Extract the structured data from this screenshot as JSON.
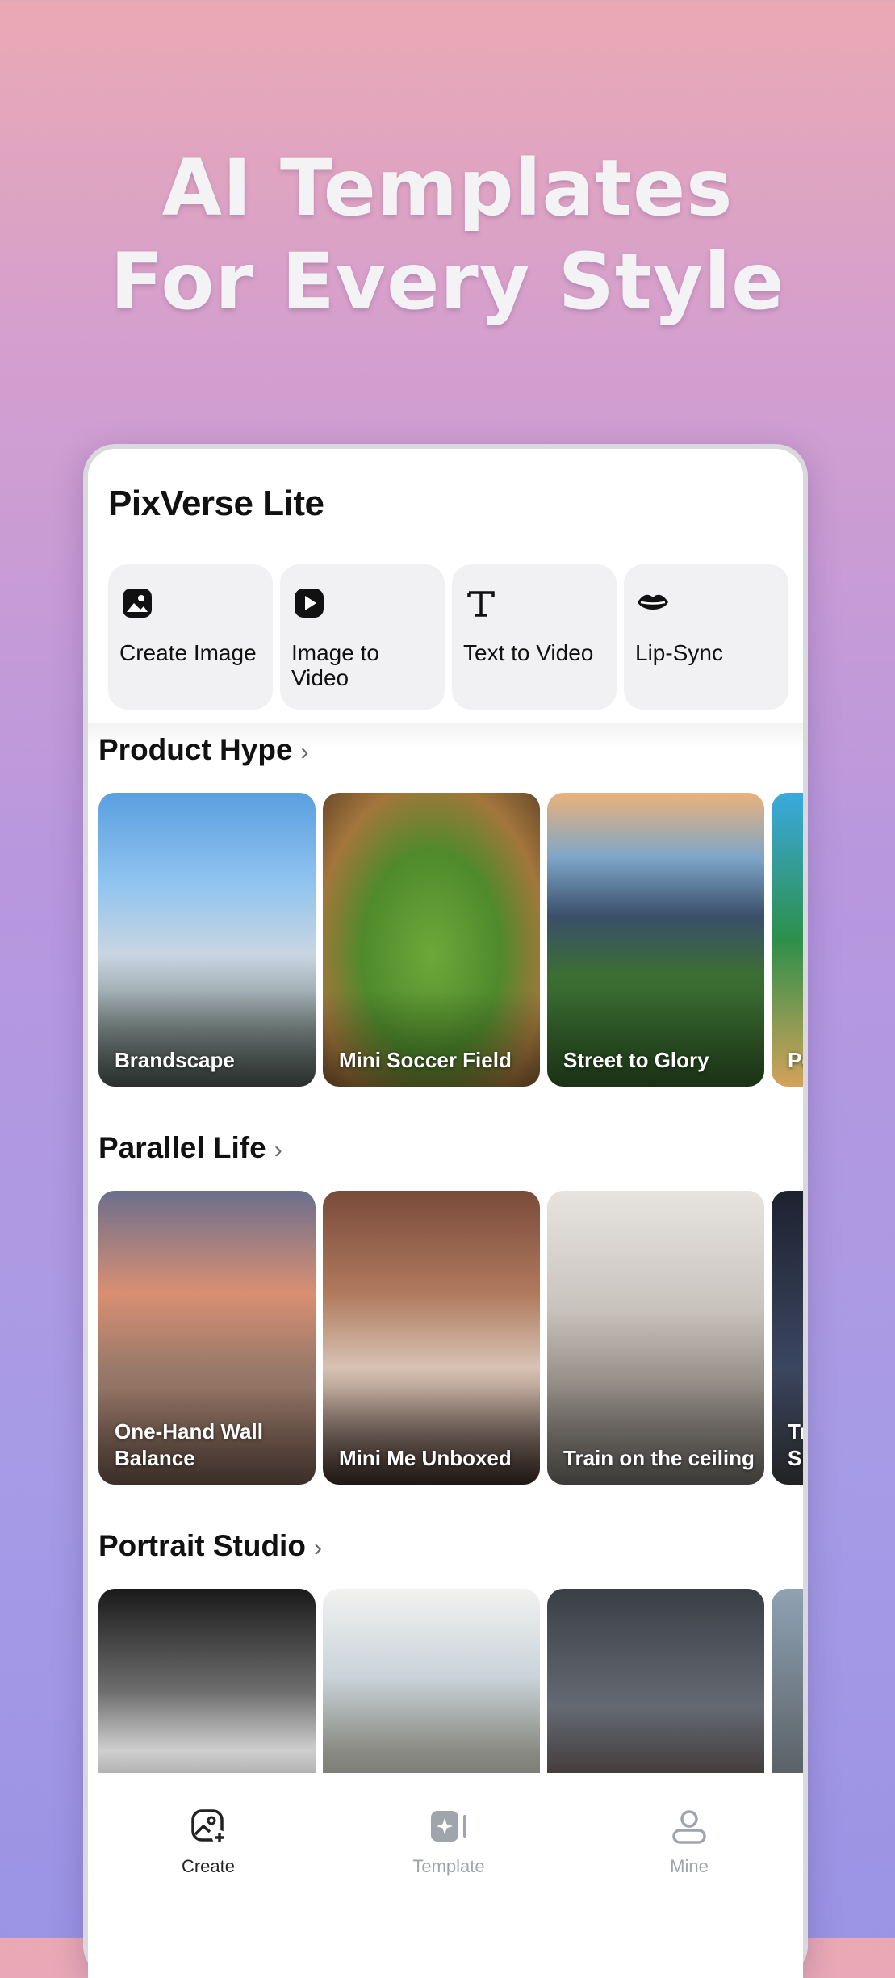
{
  "hero": {
    "line1": "AI Templates",
    "line2": "For Every Style"
  },
  "app": {
    "title": "PixVerse Lite"
  },
  "tools": [
    {
      "label": "Create Image",
      "icon": "image-icon"
    },
    {
      "label": "Image to Video",
      "icon": "play-icon"
    },
    {
      "label": "Text to Video",
      "icon": "text-icon"
    },
    {
      "label": "Lip-Sync",
      "icon": "lips-icon"
    }
  ],
  "sections": [
    {
      "title": "Product Hype",
      "cards": [
        "Brandscape",
        "Mini Soccer Field",
        "Street to Glory",
        "Po"
      ]
    },
    {
      "title": "Parallel Life",
      "cards": [
        "One-Hand Wall Balance",
        "Mini Me Unboxed",
        "Train on the ceiling",
        "Tr Si"
      ]
    },
    {
      "title": "Portrait Studio",
      "cards": [
        "",
        "",
        "",
        ""
      ]
    }
  ],
  "tabbar": {
    "create": "Create",
    "template": "Template",
    "mine": "Mine"
  },
  "colors": {
    "active": "#222222",
    "inactive": "#a0a4ad"
  }
}
